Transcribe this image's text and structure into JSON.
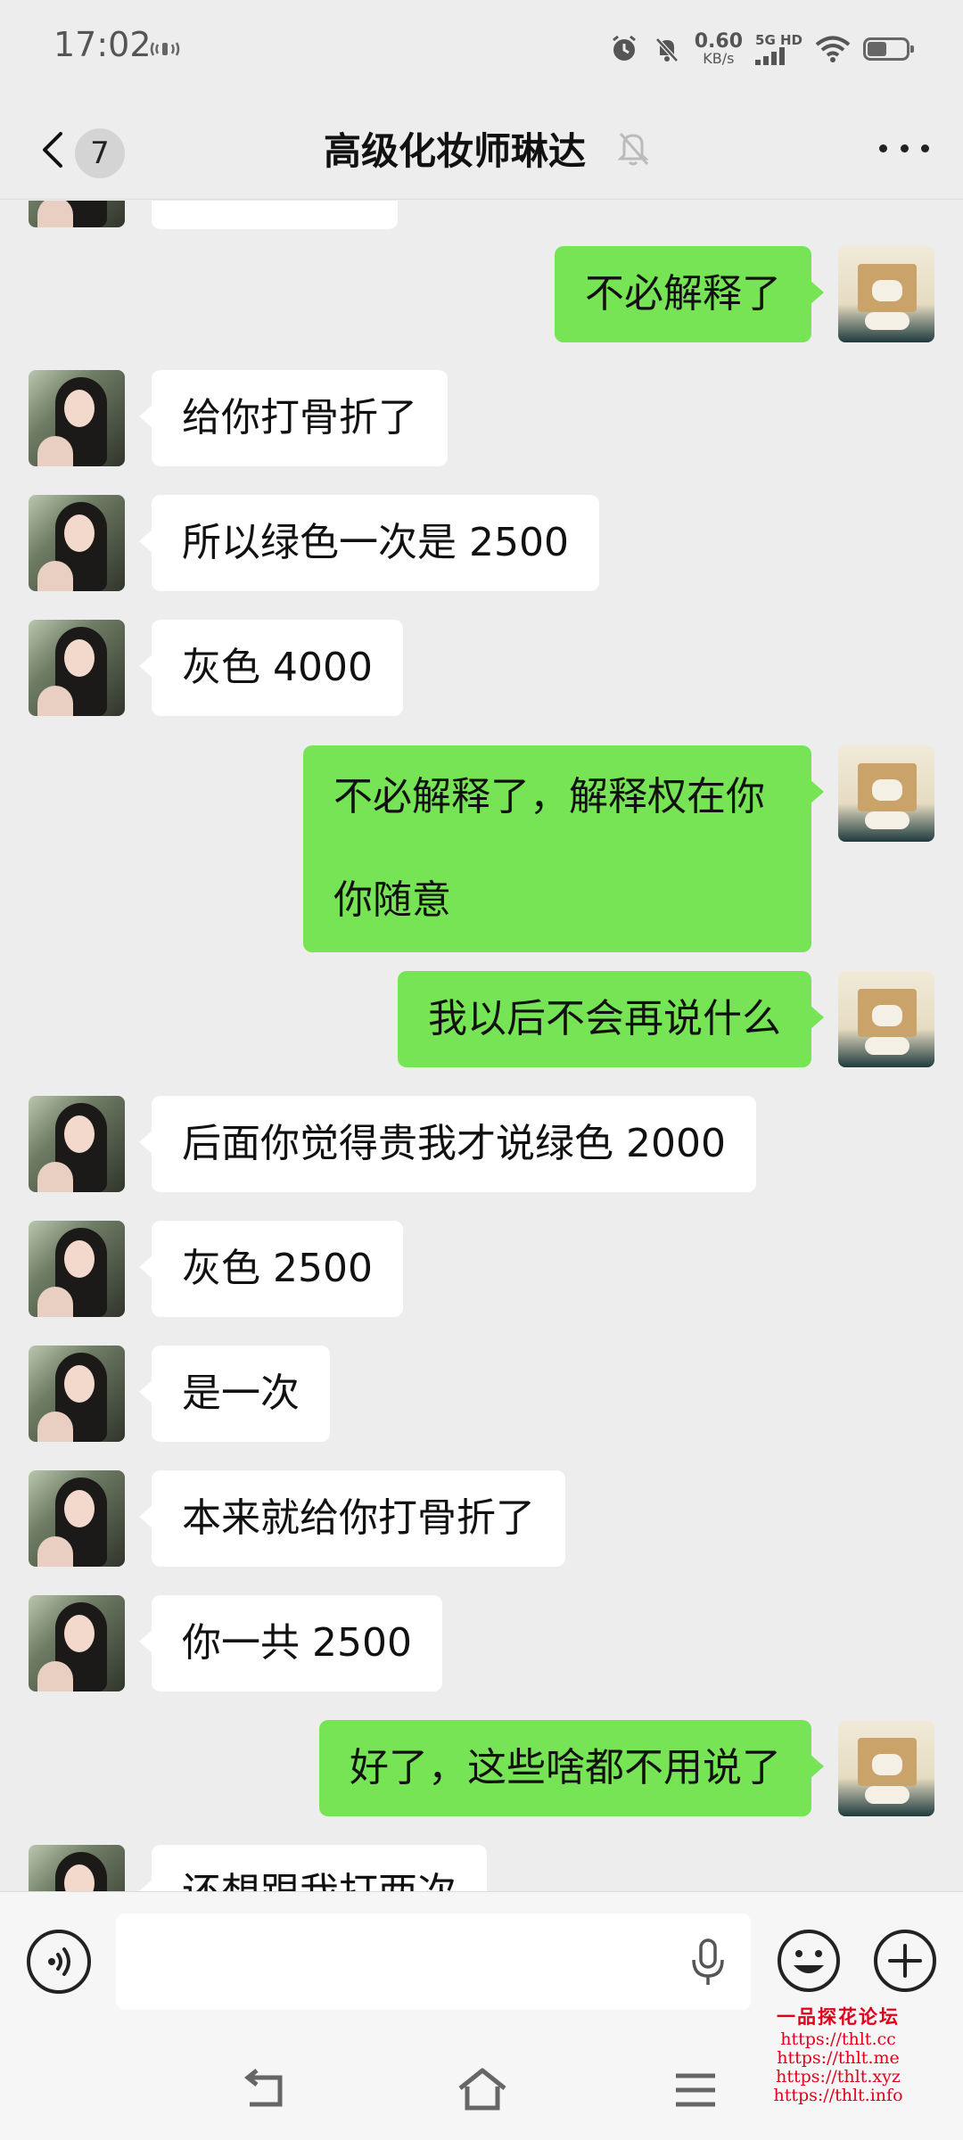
{
  "status_bar": {
    "time": "17:02",
    "net_speed_value": "0.60",
    "net_speed_unit": "KB/s",
    "net_type": "5G HD",
    "battery_level": 0.45
  },
  "header": {
    "back_count": "7",
    "title": "高级化妆师琳达"
  },
  "messages": [
    {
      "side": "in",
      "text": "给你打骨折了"
    },
    {
      "side": "out",
      "text": "不必解释了"
    },
    {
      "side": "in",
      "text": "所以绿色一次是 2500"
    },
    {
      "side": "in",
      "text": "灰色 4000"
    },
    {
      "side": "out",
      "text": "不必解释了，解释权在你你随意"
    },
    {
      "side": "out",
      "text": "我以后不会再说什么"
    },
    {
      "side": "in",
      "text": "后面你觉得贵我才说绿色 2000"
    },
    {
      "side": "in",
      "text": "灰色 2500"
    },
    {
      "side": "in",
      "text": "是一次"
    },
    {
      "side": "in",
      "text": "本来就给你打骨折了"
    },
    {
      "side": "in",
      "text": "你一共 2500"
    },
    {
      "side": "out",
      "text": "好了，这些啥都不用说了"
    },
    {
      "side": "in",
      "text": "还想跟我打两次"
    }
  ],
  "watermark": {
    "title": "一品探花论坛",
    "links": [
      "https://thlt.cc",
      "https://thlt.me",
      "https://thlt.xyz",
      "https://thlt.info"
    ]
  }
}
